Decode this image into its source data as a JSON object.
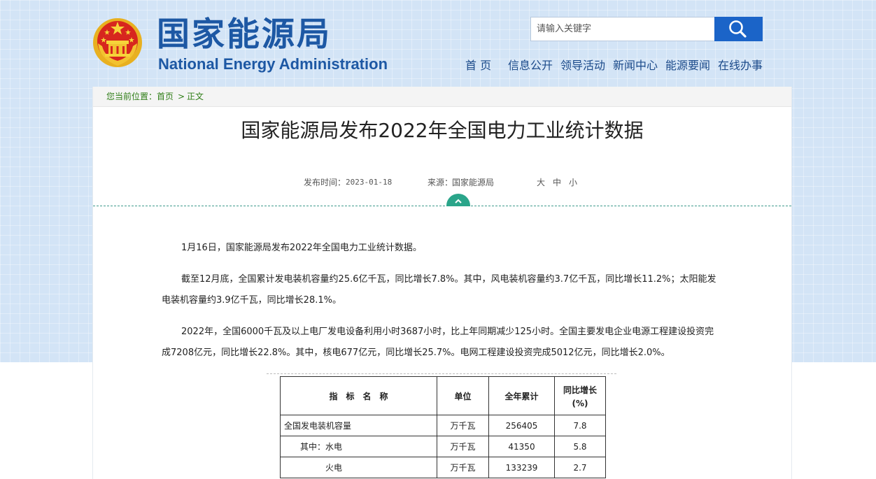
{
  "site": {
    "name_cn": "国家能源局",
    "name_en": "National Energy Administration",
    "colors": {
      "brand_blue": "#1d58a4",
      "search_button": "#1b64c8",
      "accent_green": "#2aa58a"
    }
  },
  "search": {
    "placeholder": "请输入关键字",
    "button_icon": "search-icon"
  },
  "nav": {
    "items": [
      {
        "label": "首 页"
      },
      {
        "label": "信息公开"
      },
      {
        "label": "领导活动"
      },
      {
        "label": "新闻中心"
      },
      {
        "label": "能源要闻"
      },
      {
        "label": "在线办事"
      }
    ]
  },
  "breadcrumb": {
    "prefix": "您当前位置：",
    "home": "首页",
    "separator": ">",
    "current": "正文"
  },
  "article": {
    "title": "国家能源局发布2022年全国电力工业统计数据",
    "publish_label": "发布时间：",
    "publish_date": "2023-01-18",
    "source_label": "来源：",
    "source": "国家能源局",
    "font_sizes": [
      "大",
      "中",
      "小"
    ],
    "paragraphs": [
      "1月16日，国家能源局发布2022年全国电力工业统计数据。",
      "截至12月底，全国累计发电装机容量约25.6亿千瓦，同比增长7.8%。其中，风电装机容量约3.7亿千瓦，同比增长11.2%；太阳能发电装机容量约3.9亿千瓦，同比增长28.1%。",
      "2022年，全国6000千瓦及以上电厂发电设备利用小时3687小时，比上年同期减少125小时。全国主要发电企业电源工程建设投资完成7208亿元，同比增长22.8%。其中，核电677亿元，同比增长25.7%。电网工程建设投资完成5012亿元，同比增长2.0%。"
    ]
  },
  "table": {
    "headers": [
      "指　标　名　称",
      "单位",
      "全年累计",
      "同比增长",
      "(%)"
    ],
    "rows": [
      {
        "name": "全国发电装机容量",
        "unit": "万千瓦",
        "total": "256405",
        "growth": "7.8"
      },
      {
        "name": "其中：水电",
        "unit": "万千瓦",
        "total": "41350",
        "growth": "5.8"
      },
      {
        "name": "火电",
        "unit": "万千瓦",
        "total": "133239",
        "growth": "2.7"
      }
    ]
  }
}
